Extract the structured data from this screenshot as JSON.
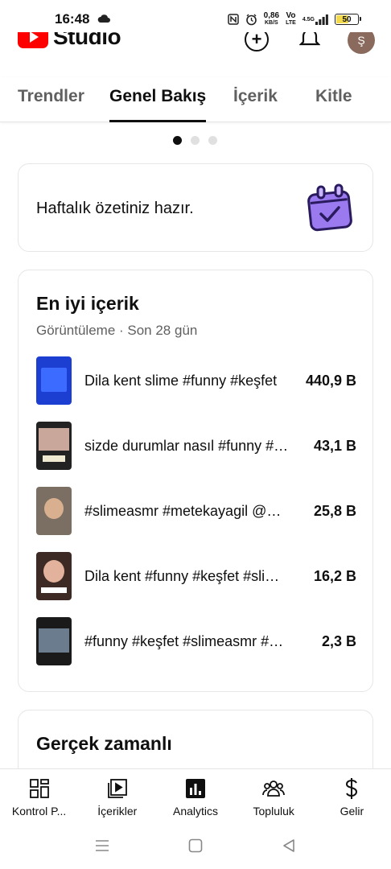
{
  "status_bar": {
    "time": "16:48",
    "speed_value": "0,86",
    "speed_unit": "KB/S",
    "volte_top": "Vo",
    "volte_bottom": "LTE",
    "network": "4.5G",
    "battery": "50"
  },
  "app": {
    "logo_text": "Studio",
    "avatar_letter": "Ş"
  },
  "tabs": [
    {
      "label": "Trendler",
      "active": false
    },
    {
      "label": "Genel Bakış",
      "active": true
    },
    {
      "label": "İçerik",
      "active": false
    },
    {
      "label": "Kitle",
      "active": false
    }
  ],
  "carousel": {
    "count": 3,
    "active_index": 0
  },
  "weekly_card": {
    "text": "Haftalık özetiniz hazır."
  },
  "top_content": {
    "title": "En iyi içerik",
    "subtitle": "Görüntüleme · Son 28 gün",
    "items": [
      {
        "title": "Dila kent slime #funny #keşfet",
        "value": "440,9 B"
      },
      {
        "title": "sizde durumlar nasıl #funny #keşfet",
        "value": "43,1 B"
      },
      {
        "title": "#slimeasmr #metekayagil @metekayagil",
        "value": "25,8 B"
      },
      {
        "title": "Dila kent #funny #keşfet #slimeasmr",
        "value": "16,2 B"
      },
      {
        "title": "#funny #keşfet #slimeasmr #comedy",
        "value": "2,3 B"
      }
    ]
  },
  "realtime_card": {
    "title": "Gerçek zamanlı"
  },
  "bottom_nav": [
    {
      "label": "Kontrol P...",
      "icon": "dashboard-icon"
    },
    {
      "label": "İçerikler",
      "icon": "content-icon"
    },
    {
      "label": "Analytics",
      "icon": "analytics-icon"
    },
    {
      "label": "Topluluk",
      "icon": "community-icon"
    },
    {
      "label": "Gelir",
      "icon": "earn-icon"
    }
  ],
  "colors": {
    "brand_red": "#ff0000",
    "accent_purple": "#9b7af0"
  }
}
